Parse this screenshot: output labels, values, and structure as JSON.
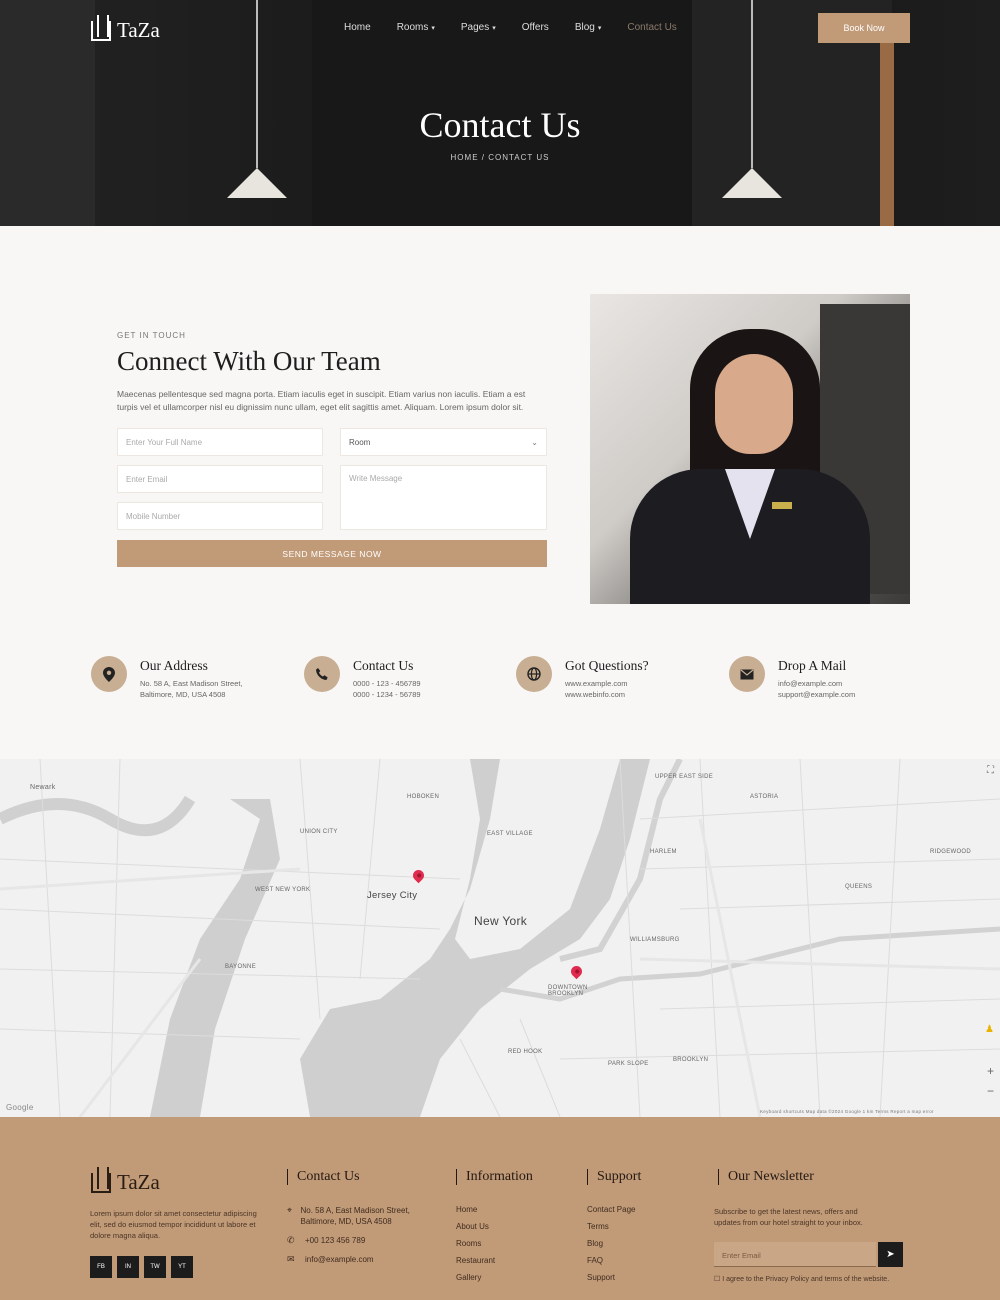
{
  "brand": {
    "name": "TaZa"
  },
  "nav": {
    "items": [
      {
        "label": "Home",
        "has_dropdown": false
      },
      {
        "label": "Rooms",
        "has_dropdown": true
      },
      {
        "label": "Pages",
        "has_dropdown": true
      },
      {
        "label": "Offers",
        "has_dropdown": false
      },
      {
        "label": "Blog",
        "has_dropdown": true
      },
      {
        "label": "Contact Us",
        "has_dropdown": false,
        "active": true
      }
    ],
    "cta": "Book Now"
  },
  "hero": {
    "title": "Contact Us",
    "breadcrumb": "HOME  /  CONTACT US"
  },
  "contact": {
    "eyebrow": "GET IN TOUCH",
    "title": "Connect With Our Team",
    "description": "Maecenas pellentesque sed magna porta. Etiam iaculis eget in suscipit. Etiam varius non iaculis. Etiam a est turpis vel et ullamcorper nisl eu dignissim nunc ullam, eget elit sagittis amet. Aliquam. Lorem ipsum dolor sit.",
    "fields": {
      "name_placeholder": "Enter Your Full Name",
      "email_placeholder": "Enter Email",
      "phone_placeholder": "Mobile Number",
      "select_value": "Room",
      "message_placeholder": "Write Message"
    },
    "submit": "SEND MESSAGE NOW"
  },
  "info": [
    {
      "icon": "map-pin-icon",
      "glyph": "⬤",
      "title": "Our Address",
      "lines": [
        "No. 58 A, East Madison Street,",
        "Baltimore, MD, USA 4508"
      ]
    },
    {
      "icon": "phone-icon",
      "glyph": "✆",
      "title": "Contact Us",
      "lines": [
        "0000 - 123 - 456789",
        "0000 - 1234 - 56789"
      ]
    },
    {
      "icon": "globe-icon",
      "glyph": "⊕",
      "title": "Got Questions?",
      "lines": [
        "www.example.com",
        "www.webinfo.com"
      ]
    },
    {
      "icon": "mail-icon",
      "glyph": "✉",
      "title": "Drop A Mail",
      "lines": [
        "info@example.com",
        "support@example.com"
      ]
    }
  ],
  "map": {
    "labels": {
      "new_york": "New York",
      "jersey_city": "Jersey City",
      "brooklyn": "BROOKLYN",
      "hoboken": "HOBOKEN",
      "manhattan": "EAST VILLAGE",
      "williamsburg": "WILLIAMSBURG",
      "harlem": "HARLEM",
      "queens": "QUEENS",
      "bayonne": "BAYONNE",
      "astoria": "ASTORIA",
      "downtown": "DOWNTOWN BROOKLYN",
      "upper_east": "UPPER EAST SIDE",
      "union_city": "UNION CITY",
      "west_new_york": "WEST NEW YORK",
      "ridgewood": "RIDGEWOOD",
      "park_slope": "PARK SLOPE",
      "red_hook": "RED HOOK",
      "newark": "Newark",
      "google": "Google",
      "map_attrib": "Keyboard shortcuts   Map data ©2024 Google   1 km   Terms   Report a map error"
    }
  },
  "footer": {
    "about": "Lorem ipsum dolor sit amet consectetur adipiscing elit, sed do eiusmod tempor incididunt ut labore et dolore magna aliqua.",
    "social": [
      "FB",
      "IN",
      "TW",
      "YT"
    ],
    "contact": {
      "title": "Contact Us",
      "address": "No. 58 A, East Madison Street, Baltimore, MD, USA 4508",
      "phone": "+00 123 456 789",
      "email": "info@example.com"
    },
    "information": {
      "title": "Information",
      "links": [
        "Home",
        "About Us",
        "Rooms",
        "Restaurant",
        "Gallery"
      ]
    },
    "support": {
      "title": "Support",
      "links": [
        "Contact Page",
        "Terms",
        "Blog",
        "FAQ",
        "Support"
      ]
    },
    "newsletter": {
      "title": "Our Newsletter",
      "text": "Subscribe to get the latest news, offers and updates from our hotel straight to your inbox.",
      "placeholder": "Enter Email",
      "agree": "I agree to the Privacy Policy and terms of the website."
    }
  }
}
